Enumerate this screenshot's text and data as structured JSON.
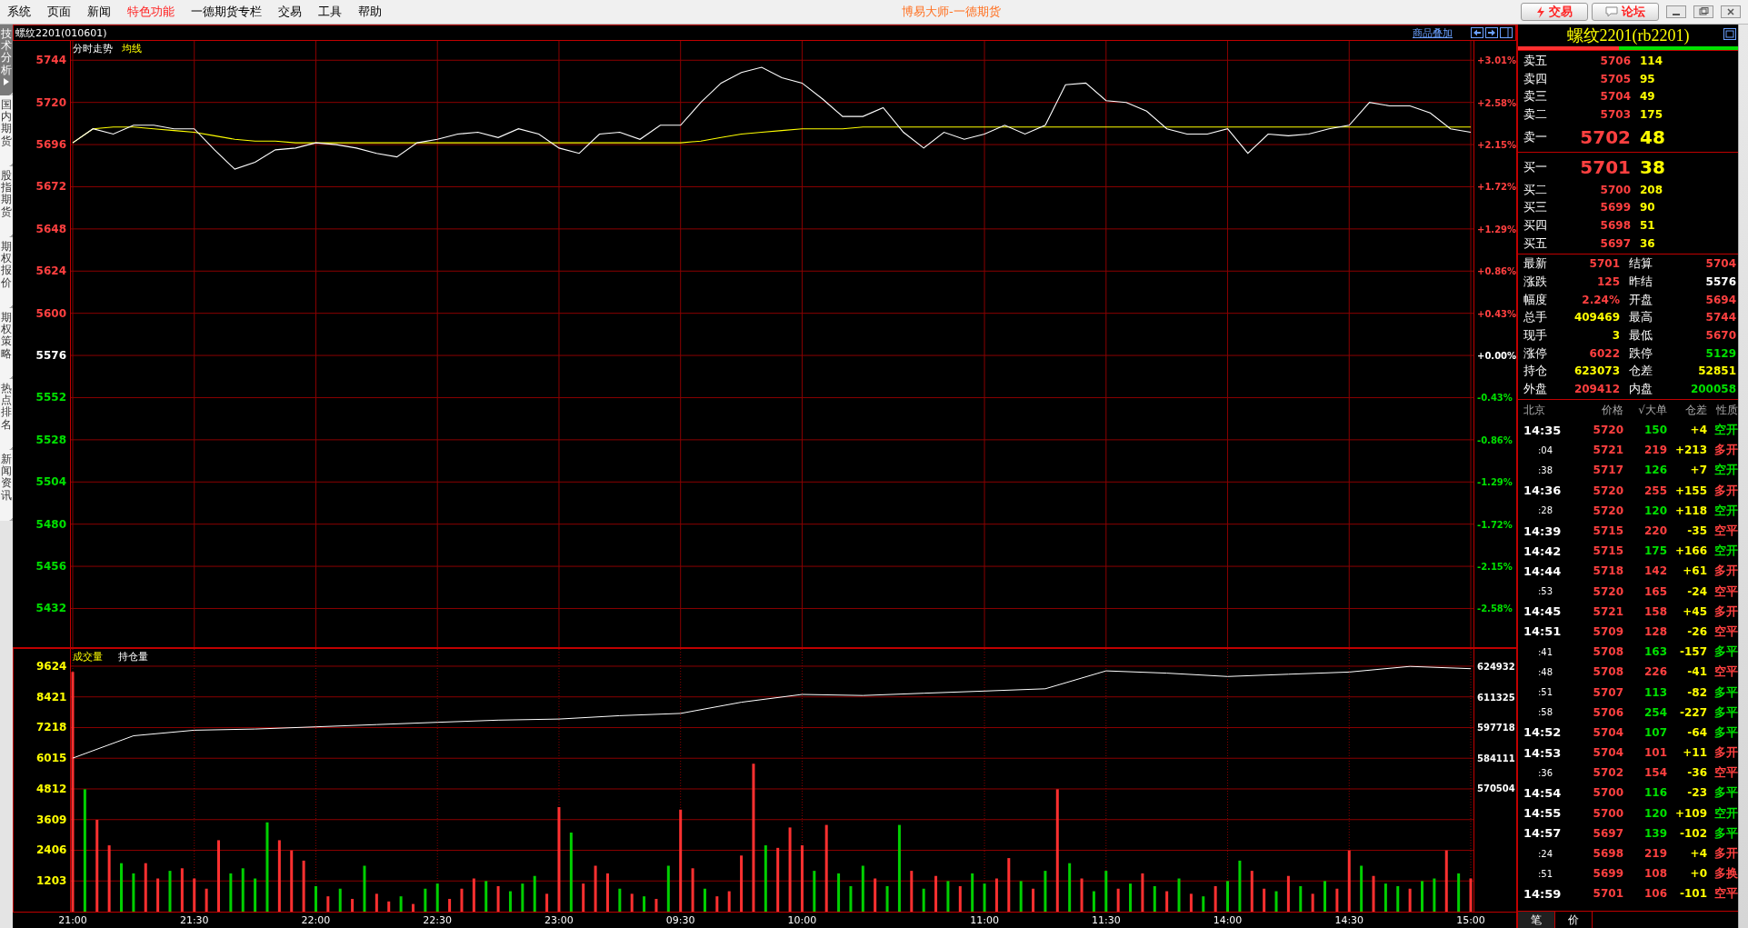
{
  "menu": {
    "items": [
      {
        "label": "系统",
        "highlighted": false
      },
      {
        "label": "页面",
        "highlighted": false
      },
      {
        "label": "新闻",
        "highlighted": false
      },
      {
        "label": "特色功能",
        "highlighted": true
      },
      {
        "label": "一德期货专栏",
        "highlighted": false
      },
      {
        "label": "交易",
        "highlighted": false
      },
      {
        "label": "工具",
        "highlighted": false
      },
      {
        "label": "帮助",
        "highlighted": false
      }
    ],
    "title": "博易大师-一德期货",
    "buttons": [
      {
        "label": "交易",
        "kind": "trade"
      },
      {
        "label": "论坛",
        "kind": "forum"
      }
    ]
  },
  "sidebar": {
    "tabs": [
      {
        "label": "技术分析",
        "selected": true
      },
      {
        "label": "国内期货",
        "selected": false
      },
      {
        "label": "股指期货",
        "selected": false
      },
      {
        "label": "期权报价",
        "selected": false
      },
      {
        "label": "期权策略",
        "selected": false
      },
      {
        "label": "热点排名",
        "selected": false
      },
      {
        "label": "新闻资讯",
        "selected": false
      }
    ]
  },
  "chart_header": {
    "title": "螺纹2201(010601)",
    "overlay_link": "商品叠加"
  },
  "price_panel": {
    "percent_labels": [
      "+3.01%",
      "+2.58%",
      "+2.15%",
      "+1.72%",
      "+1.29%",
      "+0.86%",
      "+0.43%",
      "+0.00%",
      "-0.43%",
      "-0.86%",
      "-1.29%",
      "-1.72%",
      "-2.15%",
      "-2.58%"
    ],
    "chart_data": {
      "type": "line",
      "categories": [
        null,
        null,
        null,
        null,
        null,
        null,
        null,
        null,
        null,
        null,
        null,
        null,
        null,
        null,
        null,
        null,
        null,
        null,
        null,
        null,
        null,
        null,
        null,
        null,
        null,
        null,
        null,
        null,
        null,
        null,
        null,
        null,
        null,
        null,
        null,
        null,
        null,
        null,
        null,
        null,
        null,
        null,
        null,
        null,
        null,
        null,
        null,
        null,
        null,
        null,
        null,
        null,
        null,
        null,
        null,
        null,
        null,
        null,
        null,
        null,
        null,
        null,
        null,
        null,
        null,
        null,
        null,
        null,
        null,
        null
      ],
      "series": [
        {
          "name": "分时走势",
          "color": "#ffffff",
          "values": [
            5697,
            5705,
            5702,
            5707,
            5707,
            5705,
            5705,
            5693,
            5682,
            5686,
            5693,
            5694,
            5697,
            5696,
            5694,
            5691,
            5689,
            5697,
            5699,
            5702,
            5703,
            5700,
            5705,
            5702,
            5694,
            5691,
            5702,
            5703,
            5699,
            5707,
            5707,
            5720,
            5731,
            5737,
            5740,
            5734,
            5731,
            5722,
            5712,
            5712,
            5717,
            5703,
            5694,
            5703,
            5699,
            5702,
            5707,
            5702,
            5707,
            5730,
            5731,
            5721,
            5720,
            5715,
            5705,
            5702,
            5702,
            5705,
            5691,
            5702,
            5701,
            5702,
            5705,
            5707,
            5720,
            5718,
            5718,
            5714,
            5705,
            5703
          ]
        },
        {
          "name": "均线",
          "color": "#ffff00",
          "values": [
            5697,
            5705,
            5706,
            5706,
            5705,
            5704,
            5703,
            5701,
            5699,
            5698,
            5698,
            5697,
            5697,
            5697,
            5697,
            5697,
            5697,
            5697,
            5697,
            5697,
            5697,
            5697,
            5697,
            5697,
            5697,
            5697,
            5697,
            5697,
            5697,
            5697,
            5697,
            5698,
            5700,
            5702,
            5703,
            5704,
            5705,
            5705,
            5705,
            5706,
            5706,
            5706,
            5706,
            5706,
            5706,
            5706,
            5706,
            5706,
            5706,
            5706,
            5706,
            5706,
            5706,
            5706,
            5706,
            5706,
            5706,
            5706,
            5706,
            5706,
            5706,
            5706,
            5706,
            5706,
            5706,
            5706,
            5706,
            5706,
            5706,
            5706
          ]
        }
      ],
      "ylim": [
        5410,
        5755
      ],
      "grid": true,
      "yticks": [
        5744,
        5720,
        5696,
        5672,
        5648,
        5624,
        5600,
        5576,
        5552,
        5528,
        5504,
        5480,
        5456,
        5432
      ]
    }
  },
  "volume_panel": {
    "volume": {
      "chart_data": {
        "type": "bar",
        "title": "成交量",
        "stacked": true,
        "grid": true,
        "categories": [
          "21:00",
          null,
          null,
          null,
          null,
          null,
          null,
          null,
          null,
          null,
          "21:30",
          null,
          null,
          null,
          null,
          null,
          null,
          null,
          null,
          null,
          "22:00",
          null,
          null,
          null,
          null,
          null,
          null,
          null,
          null,
          null,
          "22:30",
          null,
          null,
          null,
          null,
          null,
          null,
          null,
          null,
          null,
          "23:00",
          null,
          null,
          null,
          null,
          null,
          null,
          null,
          null,
          null,
          "09:30",
          null,
          null,
          null,
          null,
          null,
          null,
          null,
          null,
          null,
          "10:00",
          null,
          null,
          null,
          null,
          null,
          null,
          null,
          null,
          null,
          null,
          null,
          null,
          null,
          null,
          "11:00",
          null,
          null,
          null,
          null,
          null,
          null,
          null,
          null,
          null,
          "11:30",
          null,
          null,
          null,
          null,
          null,
          null,
          null,
          null,
          null,
          "14:00",
          null,
          null,
          null,
          null,
          null,
          null,
          null,
          null,
          null,
          "14:30",
          null,
          null,
          null,
          null,
          null,
          null,
          null,
          null,
          null,
          "15:00"
        ],
        "series": [
          {
            "color": "#ff3030",
            "values": [
              9400,
              null,
              3600,
              2600,
              null,
              null,
              1900,
              1300,
              null,
              1700,
              1300,
              900,
              2800,
              null,
              null,
              null,
              null,
              2800,
              2400,
              2000,
              null,
              600,
              null,
              500,
              null,
              700,
              400,
              null,
              300,
              null,
              null,
              500,
              900,
              1300,
              null,
              1000,
              null,
              null,
              null,
              700,
              4100,
              null,
              1100,
              1800,
              1500,
              null,
              700,
              null,
              500,
              null,
              4000,
              1700,
              null,
              600,
              800,
              2200,
              5800,
              null,
              2500,
              3300,
              2600,
              null,
              3400,
              null,
              null,
              null,
              1300,
              null,
              null,
              1600,
              null,
              1400,
              null,
              1000,
              null,
              null,
              1300,
              2100,
              null,
              900,
              null,
              4800,
              null,
              1300,
              null,
              null,
              900,
              null,
              1500,
              null,
              800,
              null,
              700,
              null,
              1000,
              null,
              null,
              1600,
              900,
              null,
              1400,
              null,
              700,
              null,
              900,
              2400,
              null,
              1400,
              null,
              null,
              900,
              null,
              null,
              2400,
              null,
              1300
            ]
          },
          {
            "color": "#00d000",
            "values": [
              null,
              4800,
              null,
              null,
              1900,
              1500,
              null,
              null,
              1600,
              null,
              null,
              null,
              null,
              1500,
              1700,
              1300,
              3500,
              null,
              null,
              null,
              1000,
              null,
              900,
              null,
              1800,
              null,
              null,
              600,
              null,
              900,
              1100,
              null,
              null,
              null,
              1200,
              null,
              800,
              1100,
              1400,
              null,
              null,
              3100,
              null,
              null,
              null,
              900,
              null,
              600,
              null,
              1800,
              null,
              null,
              900,
              null,
              null,
              null,
              null,
              2600,
              null,
              null,
              null,
              1600,
              null,
              1500,
              1000,
              1800,
              null,
              1000,
              3400,
              null,
              900,
              null,
              1200,
              null,
              1500,
              1100,
              null,
              null,
              1200,
              null,
              1600,
              null,
              1900,
              null,
              800,
              1600,
              null,
              1100,
              null,
              1000,
              null,
              1300,
              null,
              600,
              null,
              1200,
              2000,
              null,
              null,
              800,
              null,
              1000,
              null,
              1200,
              null,
              null,
              1800,
              null,
              1100,
              1000,
              null,
              1200,
              1300,
              null,
              1500,
              null
            ]
          }
        ],
        "ylim": [
          0,
          10300
        ],
        "yticks": [
          9624,
          8421,
          7218,
          6015,
          4812,
          3609,
          2406,
          1203
        ]
      }
    },
    "open_interest": {
      "chart_data": {
        "type": "line",
        "categories": [
          null,
          null,
          null,
          null,
          null,
          null,
          null,
          null,
          null,
          null,
          null,
          null,
          null,
          null,
          null,
          null,
          null,
          null,
          null,
          null,
          null,
          null,
          null,
          null
        ],
        "series": [
          {
            "name": "持仓量",
            "color": "#ffffff",
            "values": [
              584000,
              594000,
              596500,
              597000,
              598000,
              599000,
              600000,
              601000,
              601500,
              603000,
              604000,
              609000,
              612500,
              612000,
              613000,
              614000,
              615000,
              623000,
              622000,
              620500,
              621500,
              622500,
              625000,
              624000
            ]
          }
        ],
        "ylim": [
          515400,
          632800
        ],
        "yticks": [
          624932,
          611325,
          597718,
          584111,
          570504
        ]
      }
    }
  },
  "quote_panel": {
    "title": "螺纹2201(rb2201)",
    "ratio_bar": {
      "level": 0.46
    },
    "asks": [
      {
        "label": "卖五",
        "price": "5706",
        "volume": "114",
        "kind": "level"
      },
      {
        "label": "卖四",
        "price": "5705",
        "volume": "95",
        "kind": "level"
      },
      {
        "label": "卖三",
        "price": "5704",
        "volume": "49",
        "kind": "level"
      },
      {
        "label": "卖二",
        "price": "5703",
        "volume": "175",
        "kind": "level"
      },
      {
        "label": "卖一",
        "price": "5702",
        "volume": "48",
        "kind": "best"
      }
    ],
    "bids": [
      {
        "label": "买一",
        "price": "5701",
        "volume": "38",
        "kind": "best"
      },
      {
        "label": "买二",
        "price": "5700",
        "volume": "208",
        "kind": "level"
      },
      {
        "label": "买三",
        "price": "5699",
        "volume": "90",
        "kind": "level"
      },
      {
        "label": "买四",
        "price": "5698",
        "volume": "51",
        "kind": "level"
      },
      {
        "label": "买五",
        "price": "5697",
        "volume": "36",
        "kind": "level"
      }
    ],
    "stats": [
      {
        "label": "最新",
        "value": "5701",
        "color": "#ff4040"
      },
      {
        "label": "结算",
        "value": "5704",
        "color": "#ff4040"
      },
      {
        "label": "涨跌",
        "value": "125",
        "color": "#ff4040"
      },
      {
        "label": "昨结",
        "value": "5576",
        "color": "#ffffff"
      },
      {
        "label": "幅度",
        "value": "2.24%",
        "color": "#ff4040"
      },
      {
        "label": "开盘",
        "value": "5694",
        "color": "#ff4040"
      },
      {
        "label": "总手",
        "value": "409469",
        "color": "#ffff00"
      },
      {
        "label": "最高",
        "value": "5744",
        "color": "#ff4040"
      },
      {
        "label": "现手",
        "value": "3",
        "color": "#ffff00"
      },
      {
        "label": "最低",
        "value": "5670",
        "color": "#ff4040"
      },
      {
        "label": "涨停",
        "value": "6022",
        "color": "#ff4040"
      },
      {
        "label": "跌停",
        "value": "5129",
        "color": "#00e000"
      },
      {
        "label": "持仓",
        "value": "623073",
        "color": "#ffff00"
      },
      {
        "label": "仓差",
        "value": "52851",
        "color": "#ffff00"
      },
      {
        "label": "外盘",
        "value": "209412",
        "color": "#ff4040"
      },
      {
        "label": "内盘",
        "value": "200058",
        "color": "#00e000"
      }
    ],
    "ticks_header": [
      "北京",
      "价格",
      "√大单",
      "仓差",
      "性质"
    ],
    "ticks": [
      {
        "time": "14:35",
        "kind": "minute",
        "price": "5720",
        "volume": {
          "text": "150",
          "color": "#00e000"
        },
        "oi_change": "+4",
        "nature": {
          "text": "空开",
          "color": "#00e000"
        }
      },
      {
        "time": ":04",
        "kind": "second",
        "price": "5721",
        "volume": {
          "text": "219",
          "color": "#ff4040"
        },
        "oi_change": "+213",
        "nature": {
          "text": "多开",
          "color": "#ff4040"
        }
      },
      {
        "time": ":38",
        "kind": "second",
        "price": "5717",
        "volume": {
          "text": "126",
          "color": "#00e000"
        },
        "oi_change": "+7",
        "nature": {
          "text": "空开",
          "color": "#00e000"
        }
      },
      {
        "time": "14:36",
        "kind": "minute",
        "price": "5720",
        "volume": {
          "text": "255",
          "color": "#ff4040"
        },
        "oi_change": "+155",
        "nature": {
          "text": "多开",
          "color": "#ff4040"
        }
      },
      {
        "time": ":28",
        "kind": "second",
        "price": "5720",
        "volume": {
          "text": "120",
          "color": "#00e000"
        },
        "oi_change": "+118",
        "nature": {
          "text": "空开",
          "color": "#00e000"
        }
      },
      {
        "time": "14:39",
        "kind": "minute",
        "price": "5715",
        "volume": {
          "text": "220",
          "color": "#ff4040"
        },
        "oi_change": "-35",
        "nature": {
          "text": "空平",
          "color": "#ff4040"
        }
      },
      {
        "time": "14:42",
        "kind": "minute",
        "price": "5715",
        "volume": {
          "text": "175",
          "color": "#00e000"
        },
        "oi_change": "+166",
        "nature": {
          "text": "空开",
          "color": "#00e000"
        }
      },
      {
        "time": "14:44",
        "kind": "minute",
        "price": "5718",
        "volume": {
          "text": "142",
          "color": "#ff4040"
        },
        "oi_change": "+61",
        "nature": {
          "text": "多开",
          "color": "#ff4040"
        }
      },
      {
        "time": ":53",
        "kind": "second",
        "price": "5720",
        "volume": {
          "text": "165",
          "color": "#ff4040"
        },
        "oi_change": "-24",
        "nature": {
          "text": "空平",
          "color": "#ff4040"
        }
      },
      {
        "time": "14:45",
        "kind": "minute",
        "price": "5721",
        "volume": {
          "text": "158",
          "color": "#ff4040"
        },
        "oi_change": "+45",
        "nature": {
          "text": "多开",
          "color": "#ff4040"
        }
      },
      {
        "time": "14:51",
        "kind": "minute",
        "price": "5709",
        "volume": {
          "text": "128",
          "color": "#ff4040"
        },
        "oi_change": "-26",
        "nature": {
          "text": "空平",
          "color": "#ff4040"
        }
      },
      {
        "time": ":41",
        "kind": "second",
        "price": "5708",
        "volume": {
          "text": "163",
          "color": "#00e000"
        },
        "oi_change": "-157",
        "nature": {
          "text": "多平",
          "color": "#00e000"
        }
      },
      {
        "time": ":48",
        "kind": "second",
        "price": "5708",
        "volume": {
          "text": "226",
          "color": "#ff4040"
        },
        "oi_change": "-41",
        "nature": {
          "text": "空平",
          "color": "#ff4040"
        }
      },
      {
        "time": ":51",
        "kind": "second",
        "price": "5707",
        "volume": {
          "text": "113",
          "color": "#00e000"
        },
        "oi_change": "-82",
        "nature": {
          "text": "多平",
          "color": "#00e000"
        }
      },
      {
        "time": ":58",
        "kind": "second",
        "price": "5706",
        "volume": {
          "text": "254",
          "color": "#00e000"
        },
        "oi_change": "-227",
        "nature": {
          "text": "多平",
          "color": "#00e000"
        }
      },
      {
        "time": "14:52",
        "kind": "minute",
        "price": "5704",
        "volume": {
          "text": "107",
          "color": "#00e000"
        },
        "oi_change": "-64",
        "nature": {
          "text": "多平",
          "color": "#00e000"
        }
      },
      {
        "time": "14:53",
        "kind": "minute",
        "price": "5704",
        "volume": {
          "text": "101",
          "color": "#ff4040"
        },
        "oi_change": "+11",
        "nature": {
          "text": "多开",
          "color": "#ff4040"
        }
      },
      {
        "time": ":36",
        "kind": "second",
        "price": "5702",
        "volume": {
          "text": "154",
          "color": "#ff4040"
        },
        "oi_change": "-36",
        "nature": {
          "text": "空平",
          "color": "#ff4040"
        }
      },
      {
        "time": "14:54",
        "kind": "minute",
        "price": "5700",
        "volume": {
          "text": "116",
          "color": "#00e000"
        },
        "oi_change": "-23",
        "nature": {
          "text": "多平",
          "color": "#00e000"
        }
      },
      {
        "time": "14:55",
        "kind": "minute",
        "price": "5700",
        "volume": {
          "text": "120",
          "color": "#00e000"
        },
        "oi_change": "+109",
        "nature": {
          "text": "空开",
          "color": "#00e000"
        }
      },
      {
        "time": "14:57",
        "kind": "minute",
        "price": "5697",
        "volume": {
          "text": "139",
          "color": "#00e000"
        },
        "oi_change": "-102",
        "nature": {
          "text": "多平",
          "color": "#00e000"
        }
      },
      {
        "time": ":24",
        "kind": "second",
        "price": "5698",
        "volume": {
          "text": "219",
          "color": "#ff4040"
        },
        "oi_change": "+4",
        "nature": {
          "text": "多开",
          "color": "#ff4040"
        }
      },
      {
        "time": ":51",
        "kind": "second",
        "price": "5699",
        "volume": {
          "text": "108",
          "color": "#ff4040"
        },
        "oi_change": "+0",
        "nature": {
          "text": "多换",
          "color": "#ff4040"
        }
      },
      {
        "time": "14:59",
        "kind": "minute",
        "price": "5701",
        "volume": {
          "text": "106",
          "color": "#ff4040"
        },
        "oi_change": "-101",
        "nature": {
          "text": "空平",
          "color": "#ff4040"
        }
      }
    ],
    "bottom_tabs": [
      {
        "label": "笔",
        "selected": true
      },
      {
        "label": "价",
        "selected": false
      }
    ]
  }
}
